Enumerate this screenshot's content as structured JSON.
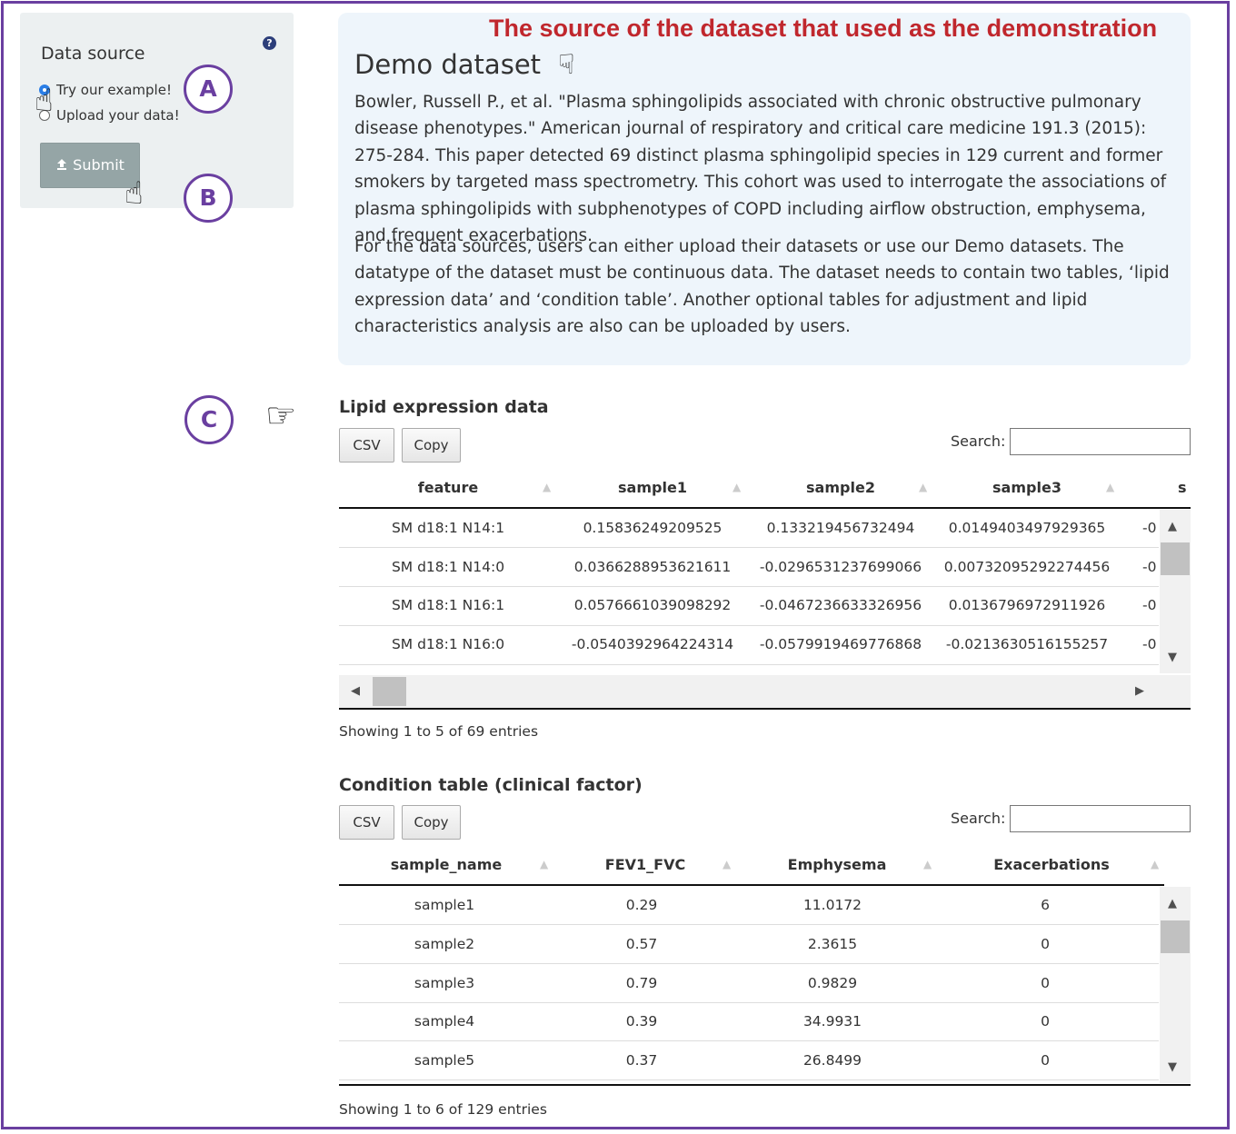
{
  "annotation": {
    "caption": "The source of the dataset that used as the demonstration",
    "markers": [
      "A",
      "B",
      "C"
    ]
  },
  "sidebar": {
    "title": "Data source",
    "help_icon": "question-circle-icon",
    "radio_options": [
      {
        "label": "Try our example!",
        "checked": true
      },
      {
        "label": "Upload your data!",
        "checked": false
      }
    ],
    "submit_label": "Submit",
    "submit_icon": "upload-icon"
  },
  "demo": {
    "title": "Demo dataset",
    "paragraph1": "Bowler, Russell P., et al. \"Plasma sphingolipids associated with chronic obstructive pulmonary disease phenotypes.\" American journal of respiratory and critical care medicine 191.3 (2015): 275-284. This paper detected 69 distinct plasma sphingolipid species in 129 current and former smokers by targeted mass spectrometry. This cohort was used to interrogate the associations of plasma sphingolipids with subphenotypes of COPD including airflow obstruction, emphysema, and frequent exacerbations.",
    "paragraph2": "For the data sources, users can either upload their datasets or use our Demo datasets. The datatype of the dataset must be continuous data. The dataset needs to contain two tables, ‘lipid expression data’ and ‘condition table’. Another optional tables for adjustment and lipid characteristics analysis are also can be uploaded by users."
  },
  "lipid_table": {
    "title": "Lipid expression data",
    "buttons": [
      "CSV",
      "Copy"
    ],
    "search_label": "Search:",
    "columns": [
      "feature",
      "sample1",
      "sample2",
      "sample3",
      "s"
    ],
    "rows": [
      [
        "SM d18:1 N14:1",
        "0.15836249209525",
        "0.133219456732494",
        "0.0149403497929365",
        "-0"
      ],
      [
        "SM d18:1 N14:0",
        "0.0366288953621611",
        "-0.0296531237699066",
        "0.00732095292274456",
        "-0"
      ],
      [
        "SM d18:1 N16:1",
        "0.0576661039098292",
        "-0.0467236633326956",
        "0.0136796972911926",
        "-0"
      ],
      [
        "SM d18:1 N16:0",
        "-0.0540392964224314",
        "-0.0579919469776868",
        "-0.0213630516155257",
        "-0"
      ]
    ],
    "info": "Showing 1 to 5 of 69 entries"
  },
  "condition_table": {
    "title": "Condition table (clinical factor)",
    "buttons": [
      "CSV",
      "Copy"
    ],
    "search_label": "Search:",
    "columns": [
      "sample_name",
      "FEV1_FVC",
      "Emphysema",
      "Exacerbations"
    ],
    "rows": [
      [
        "sample1",
        "0.29",
        "11.0172",
        "6"
      ],
      [
        "sample2",
        "0.57",
        "2.3615",
        "0"
      ],
      [
        "sample3",
        "0.79",
        "0.9829",
        "0"
      ],
      [
        "sample4",
        "0.39",
        "34.9931",
        "0"
      ],
      [
        "sample5",
        "0.37",
        "26.8499",
        "0"
      ]
    ],
    "info": "Showing 1 to 6 of 129 entries"
  }
}
